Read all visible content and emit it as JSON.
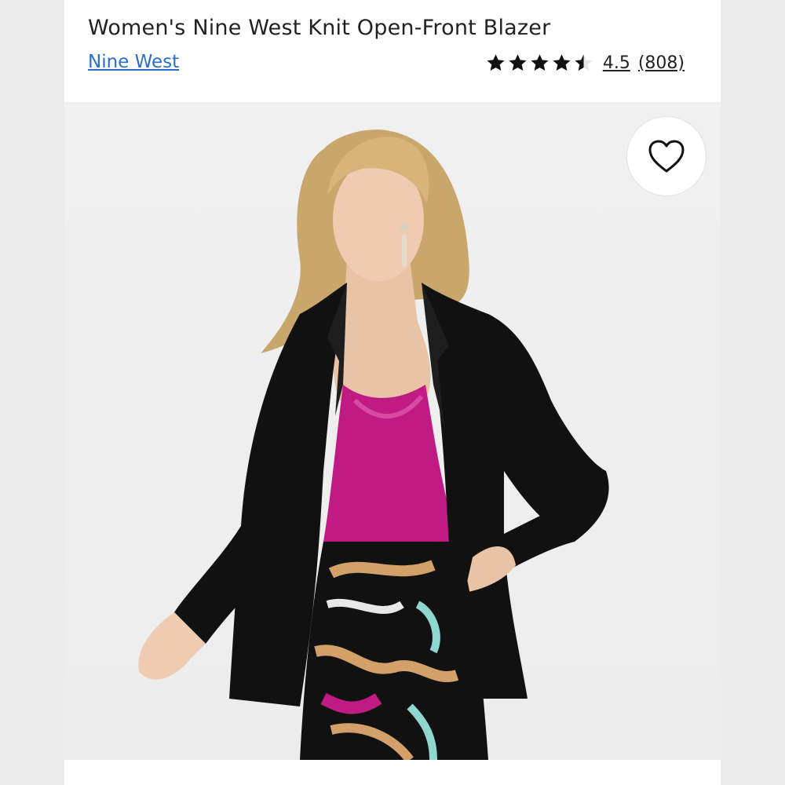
{
  "product": {
    "title": "Women's Nine West Knit Open-Front Blazer",
    "brand": "Nine West",
    "rating": {
      "stars_value": 4.5,
      "stars_max": 5,
      "value_label": "4.5",
      "count_label": "(808)"
    }
  },
  "image": {
    "favorite_icon": "heart-outline-icon",
    "subject": "model-wearing-black-blazer-icon"
  },
  "colors": {
    "brand_link": "#2a6fc9",
    "text": "#222222",
    "star": "#111111",
    "blazer": "#111111",
    "top": "#c01a84"
  }
}
